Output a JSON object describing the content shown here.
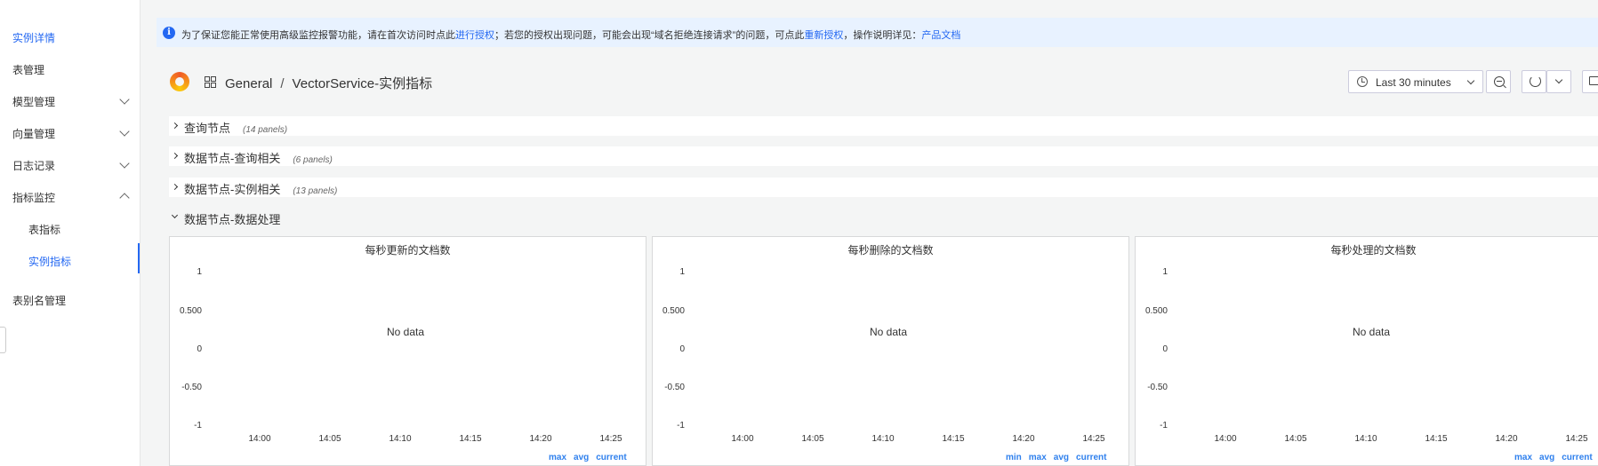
{
  "sidebar": {
    "items": [
      {
        "label": "实例详情"
      },
      {
        "label": "表管理"
      },
      {
        "label": "模型管理"
      },
      {
        "label": "向量管理"
      },
      {
        "label": "日志记录"
      },
      {
        "label": "指标监控"
      },
      {
        "label": "表指标"
      },
      {
        "label": "实例指标"
      },
      {
        "label": "表别名管理"
      }
    ]
  },
  "notice": {
    "icon": "info-icon",
    "part1": "为了保证您能正常使用高级监控报警功能，请在首次访问时点此",
    "link1": "进行授权",
    "part2": "；若您的授权出现问题，可能会出现“域名拒绝连接请求”的问题，可点此",
    "link2": "重新授权",
    "part3": "，操作说明详见：",
    "link3": "产品文档"
  },
  "header": {
    "breadcrumb_root": "General",
    "breadcrumb_sep": "/",
    "dashboard_title": "VectorService-实例指标",
    "time_range": "Last 30 minutes"
  },
  "rows": [
    {
      "title": "查询节点",
      "count": "(14 panels)"
    },
    {
      "title": "数据节点-查询相关",
      "count": "(6 panels)"
    },
    {
      "title": "数据节点-实例相关",
      "count": "(13 panels)"
    },
    {
      "title": "数据节点-数据处理"
    }
  ],
  "panels": [
    {
      "title": "每秒更新的文档数",
      "no_data": "No data",
      "y_ticks": [
        "1",
        "0.500",
        "0",
        "-0.50",
        "-1"
      ],
      "x_ticks": [
        "14:00",
        "14:05",
        "14:10",
        "14:15",
        "14:20",
        "14:25"
      ],
      "legend": [
        "max",
        "avg",
        "current"
      ]
    },
    {
      "title": "每秒删除的文档数",
      "no_data": "No data",
      "y_ticks": [
        "1",
        "0.500",
        "0",
        "-0.50",
        "-1"
      ],
      "x_ticks": [
        "14:00",
        "14:05",
        "14:10",
        "14:15",
        "14:20",
        "14:25"
      ],
      "legend": [
        "min",
        "max",
        "avg",
        "current"
      ]
    },
    {
      "title": "每秒处理的文档数",
      "no_data": "No data",
      "y_ticks": [
        "1",
        "0.500",
        "0",
        "-0.50",
        "-1"
      ],
      "x_ticks": [
        "14:00",
        "14:05",
        "14:10",
        "14:15",
        "14:20",
        "14:25"
      ],
      "legend": [
        "max",
        "avg",
        "current"
      ]
    }
  ],
  "colors": {
    "accent": "#2468f2",
    "legend": "#2f80ed",
    "notice_bg": "#e8f2ff"
  }
}
